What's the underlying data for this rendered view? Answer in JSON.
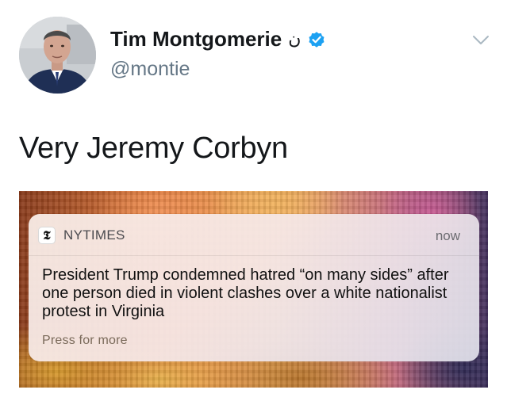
{
  "tweet": {
    "author": {
      "display_name": "Tim Montgomerie",
      "name_extra": "ن",
      "handle": "@montie",
      "verified": true
    },
    "text": "Very Jeremy Corbyn",
    "icons": {
      "verified": "verified-badge-icon",
      "menu": "chevron-down-icon"
    },
    "colors": {
      "verified": "#1da1f2",
      "chevron": "#aab8c2"
    }
  },
  "notification": {
    "app_icon": "nytimes-logo-icon",
    "app_icon_glyph": "𝕿",
    "app_name": "NYTIMES",
    "time": "now",
    "body": "President Trump condemned hatred “on many sides” after one person died in violent clashes over a white nationalist protest in Virginia",
    "action": "Press for more"
  }
}
